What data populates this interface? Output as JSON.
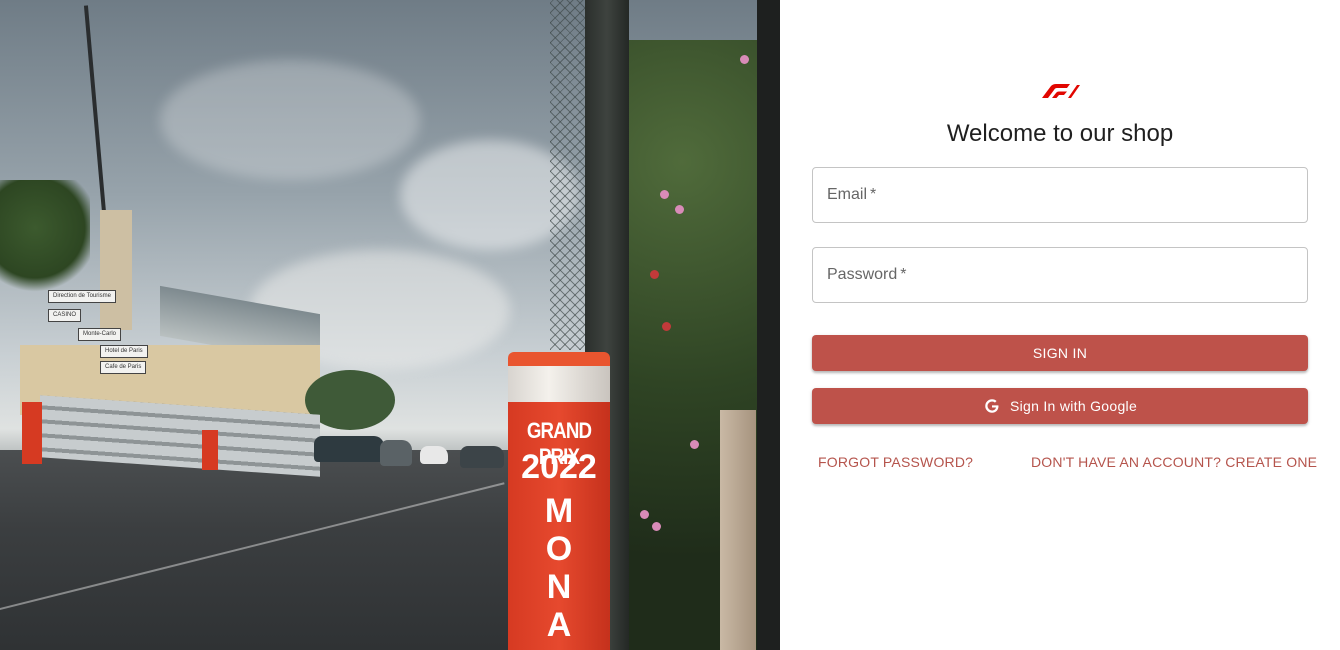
{
  "hero": {
    "image_alt": "Monaco Grand Prix 2022 street circuit photo",
    "bollard": {
      "line1": "GRAND PRIX",
      "line2": "2022",
      "line3": "MONAC"
    },
    "signs": [
      "Direction de Tourisme",
      "CASINO",
      "Monte-Carlo",
      "Hotel de Paris",
      "Cafe de Paris"
    ]
  },
  "login": {
    "logo_icon": "f1-logo-icon",
    "title": "Welcome to our shop",
    "email": {
      "label": "Email",
      "required_mark": "*",
      "value": ""
    },
    "password": {
      "label": "Password",
      "required_mark": "*",
      "value": ""
    },
    "sign_in_label": "SIGN IN",
    "google_sign_in_label": "Sign In with Google",
    "google_icon": "google-g-icon",
    "forgot_password_label": "FORGOT PASSWORD?",
    "create_account_label": "DON'T HAVE AN ACCOUNT? CREATE ONE"
  },
  "colors": {
    "primary_button": "#be524a",
    "link": "#b5544c",
    "logo_red": "#e10600"
  }
}
